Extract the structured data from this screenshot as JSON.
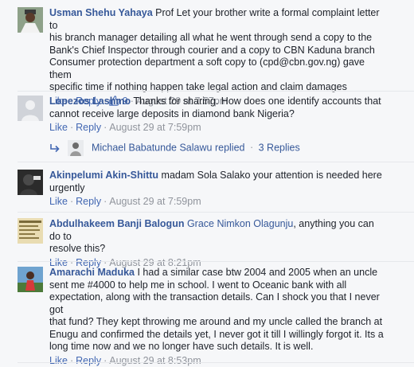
{
  "comments": [
    {
      "author": "Usman Shehu Yahaya",
      "lines": [
        "Prof Let your brother write a formal complaint letter to",
        "his branch manager detailing all what he went through send a copy to the",
        "Bank's Chief Inspector through courier and a copy to CBN Kaduna branch",
        "Consumer protection department a soft copy to (cpd@cbn.gov.ng) gave them",
        "specific time if nothing happen take legal action and claim damages"
      ],
      "like": "Like",
      "reply": "Reply",
      "likes": "9",
      "time": "August 29 at 7:57pm"
    },
    {
      "author": "Lopezos Lashmo",
      "lines": [
        "Thanks for sharing. How does one identify accounts that",
        "cannot receive large deposits in diamond bank Nigeria?"
      ],
      "like": "Like",
      "reply": "Reply",
      "time": "August 29 at 7:59pm"
    },
    {
      "author": "Akinpelumi Akin-Shittu",
      "lines": [
        "madam Sola Salako your attention is needed here",
        "urgently"
      ],
      "like": "Like",
      "reply": "Reply",
      "time": "August 29 at 7:59pm"
    },
    {
      "author": "Abdulhakeem Banji Balogun",
      "mention": "Grace Nimkon Olagunju",
      "lines": [
        ", anything you can do to",
        "resolve this?"
      ],
      "like": "Like",
      "reply": "Reply",
      "time": "August 29 at 8:21pm"
    },
    {
      "author": "Amarachi Maduka",
      "lines": [
        "I had a similar case btw 2004 and 2005 when an uncle",
        "sent me #4000 to help me in school. I went to Oceanic bank with all",
        "expectation, along with the transaction details. Can I shock you that I never got",
        "that fund? They kept throwing me around and my uncle called the branch at",
        "Enugu and confirmed the details yet, I never got it till I willingly forgot it. Its a",
        "long time now and we no longer have such details. It is well."
      ],
      "like": "Like",
      "reply": "Reply",
      "time": "August 29 at 8:53pm"
    }
  ],
  "reply_summary": {
    "name": "Michael Babatunde Salawu",
    "verb": "replied",
    "count": "3 Replies"
  },
  "colors": {
    "link": "#365899",
    "action": "#4267b2",
    "meta": "#90949c",
    "text": "#1d2129",
    "background": "#f6f7f9"
  },
  "icons": [
    "reply-arrow-icon",
    "like-thumb-icon"
  ]
}
